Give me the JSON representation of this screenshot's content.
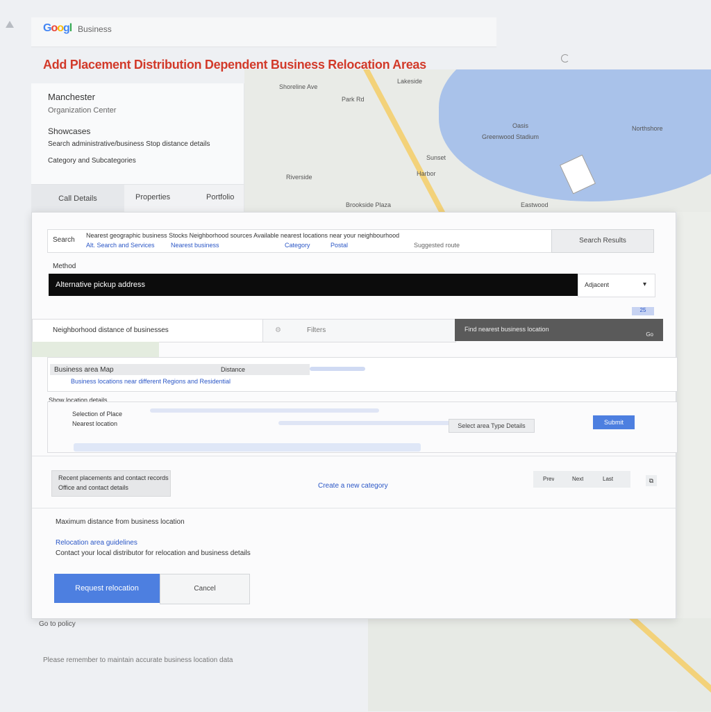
{
  "header": {
    "logo_letters": [
      "G",
      "o",
      "o",
      "g",
      "l"
    ],
    "app_name": "Business",
    "page_title": "Add Placement Distribution Dependent Business Relocation Areas"
  },
  "map": {
    "labels": [
      "Shoreline Ave",
      "Park Rd",
      "Lakeside",
      "Oasis",
      "Greenwood Stadium",
      "Sunset",
      "Riverside",
      "Harbor",
      "Northshore",
      "Brookside Plaza",
      "Eastwood"
    ]
  },
  "left_panel": {
    "name": "Manchester",
    "subtitle": "Organization Center",
    "section": "Showcases",
    "description": "Search administrative/business Stop distance details",
    "category": "Category and Subcategories",
    "tabs": [
      "Call Details",
      "Properties",
      "Portfolio"
    ]
  },
  "dialog": {
    "search_label": "Search",
    "search_text": "Nearest geographic business Stocks Neighborhood sources Available nearest locations near your neighbourhood",
    "search_links": [
      "Alt. Search and Services",
      "Nearest business",
      "Category",
      "Postal"
    ],
    "search_meta": "Suggested route",
    "search_button": "Search Results",
    "method_label": "Method",
    "selected_option": "Alternative pickup address",
    "method_side_value": "Adjacent",
    "badge": "25",
    "row2_label": "Neighborhood distance of businesses",
    "row2_mid": "Filters",
    "row2_button": "Find nearest business location",
    "row2_button_sub": "Go",
    "section1_head": "Business area Map",
    "section1_head_right": "Distance",
    "section1_link": "Business locations near different Regions and Residential",
    "section2_head": "Show location details",
    "section2_line1": "Selection of Place",
    "section2_line2": "Nearest location",
    "section2_secondary_button": "Select area Type Details",
    "section2_primary_button": "Submit",
    "summary_line1": "Recent placements and contact records",
    "summary_line2": "Office and contact details",
    "center_link": "Create a new category",
    "pagination": [
      "Prev",
      "Next",
      "Last"
    ],
    "footer_line1": "Maximum distance from business location",
    "footer_link": "Relocation area guidelines",
    "footer_line2": "Contact your local distributor for relocation and business details",
    "primary_button": "Request relocation",
    "cancel_button": "Cancel"
  },
  "page_footer": {
    "note": "Go to policy",
    "bottom_text": "Please remember to maintain accurate business location data"
  },
  "colors": {
    "title_red": "#d23a2a",
    "primary_blue": "#4d7fe0",
    "link_blue": "#2a56c6",
    "map_water": "#a9c2ea"
  }
}
